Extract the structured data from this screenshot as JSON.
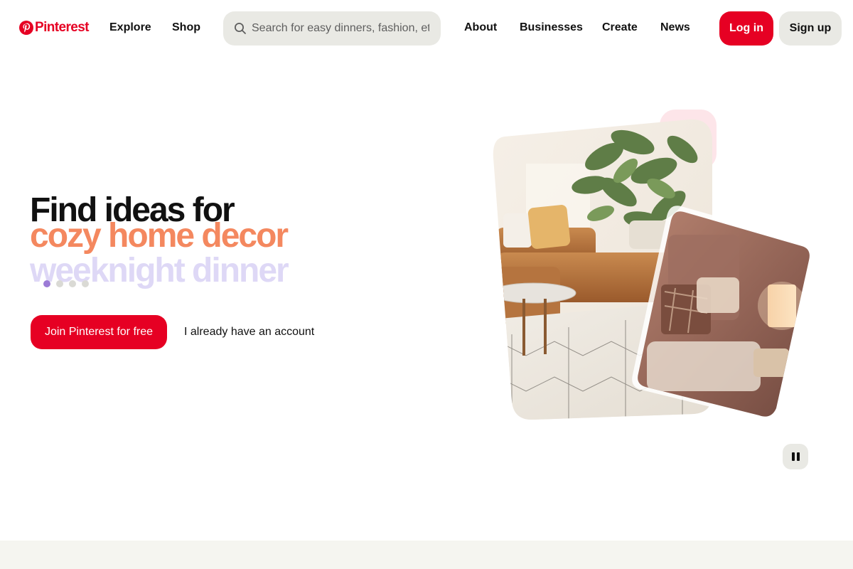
{
  "brand": {
    "name": "Pinterest",
    "color": "#e60023",
    "logo_icon": "pinterest-logo-icon"
  },
  "nav": {
    "explore": "Explore",
    "shop": "Shop",
    "about": "About",
    "businesses": "Businesses",
    "create": "Create",
    "news": "News"
  },
  "search": {
    "placeholder": "Search for easy dinners, fashion, etc.",
    "icon": "search-icon"
  },
  "auth": {
    "login_label": "Log in",
    "signup_label": "Sign up"
  },
  "hero": {
    "title": "Find ideas for",
    "topic_current": "cozy home decor",
    "topic_next": "weeknight dinner",
    "topic_current_color": "#f4885f",
    "topic_next_color": "#ded8f6",
    "carousel": {
      "total": 4,
      "active": 1,
      "active_color": "#9c7bd6"
    },
    "join_label": "Join Pinterest for free",
    "account_label": "I already have an account"
  },
  "controls": {
    "pause_icon": "pause-icon"
  },
  "colors": {
    "button_gray": "#e9e9e4",
    "footer_band": "#f5f5f0"
  }
}
